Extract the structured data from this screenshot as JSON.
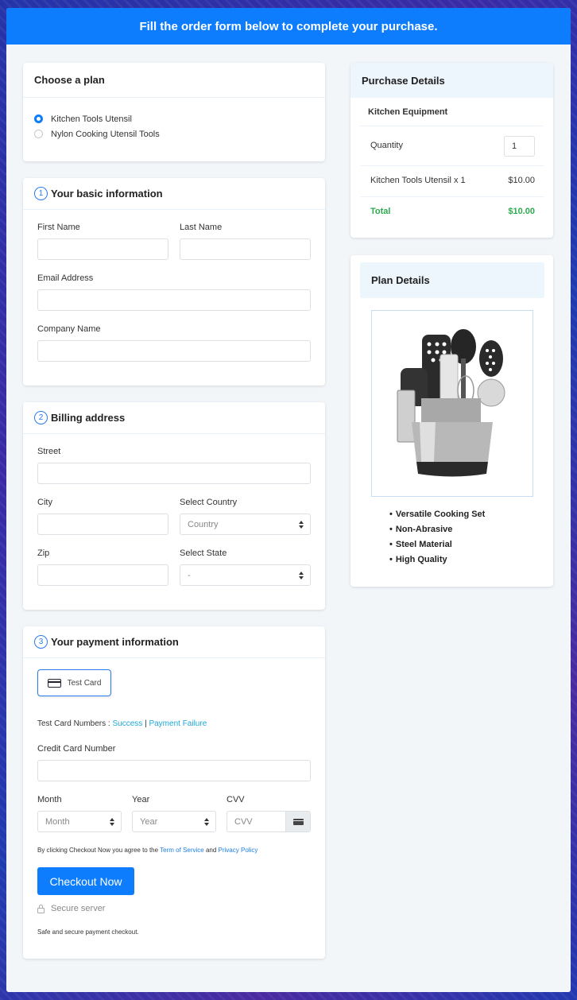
{
  "banner": {
    "title": "Fill the order form below to complete your purchase."
  },
  "plan": {
    "title": "Choose a plan",
    "options": [
      {
        "label": "Kitchen Tools Utensil",
        "selected": true
      },
      {
        "label": "Nylon Cooking Utensil Tools",
        "selected": false
      }
    ]
  },
  "basic": {
    "step": "1",
    "title": "Your basic information",
    "first_name_label": "First Name",
    "last_name_label": "Last Name",
    "email_label": "Email Address",
    "company_label": "Company Name",
    "first_name_value": "",
    "last_name_value": "",
    "email_value": "",
    "company_value": ""
  },
  "billing": {
    "step": "2",
    "title": "Billing address",
    "street_label": "Street",
    "city_label": "City",
    "country_label": "Select Country",
    "country_value": "Country",
    "zip_label": "Zip",
    "state_label": "Select State",
    "state_value": "-"
  },
  "payment": {
    "step": "3",
    "title": "Your payment information",
    "test_card_label": "Test Card",
    "test_numbers_prefix": "Test Card Numbers : ",
    "success_link": "Success",
    "separator": "|",
    "failure_link": "Payment Failure",
    "cc_label": "Credit Card Number",
    "month_label": "Month",
    "month_value": "Month",
    "year_label": "Year",
    "year_value": "Year",
    "cvv_label": "CVV",
    "cvv_placeholder": "CVV",
    "terms_prefix": "By clicking Checkout Now you agree to the ",
    "terms_link": "Term of Service",
    "terms_and": " and ",
    "privacy_link": "Privacy Policy",
    "checkout_label": "Checkout Now",
    "secure_label": "Secure server",
    "safe_text": "Safe and secure payment checkout."
  },
  "purchase": {
    "title": "Purchase Details",
    "product": "Kitchen Equipment",
    "quantity_label": "Quantity",
    "quantity_value": "1",
    "line_item": "Kitchen Tools Utensil x 1",
    "line_price": "$10.00",
    "total_label": "Total",
    "total_value": "$10.00"
  },
  "plan_details": {
    "title": "Plan Details",
    "image_alt": "Kitchen utensil set in stainless steel holder",
    "features": [
      "Versatile Cooking Set",
      "Non-Abrasive",
      "Steel Material",
      " High Quality"
    ]
  },
  "colors": {
    "accent": "#0d7dfd",
    "total_green": "#2eaa4e",
    "link": "#1fa7d6"
  }
}
